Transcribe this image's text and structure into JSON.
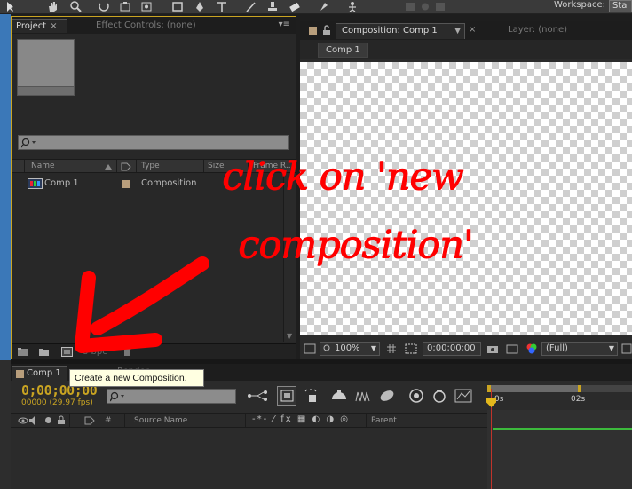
{
  "toolbar": {
    "workspace_label": "Workspace:",
    "workspace_value": "Sta",
    "tools": [
      "selection-tool",
      "hand-tool",
      "zoom-tool",
      "rotate-tool",
      "camera-tool",
      "pan-behind-tool",
      "rectangle-tool",
      "pen-tool",
      "type-tool",
      "brush-tool",
      "clone-stamp-tool",
      "eraser-tool",
      "roto-brush-tool",
      "puppet-tool"
    ]
  },
  "project_panel": {
    "tab_project": "Project",
    "tab_effect_controls": "Effect Controls: (none)",
    "columns": {
      "name": "Name",
      "type": "Type",
      "size": "Size",
      "frame_rate": "Frame R..."
    },
    "items": [
      {
        "name": "Comp 1",
        "type": "Composition",
        "size": "",
        "frame_rate": ""
      }
    ],
    "bit_depth": "8 bpc"
  },
  "comp_panel": {
    "tab_composition": "Composition: Comp 1",
    "tab_layer": "Layer: (none)",
    "subtab": "Comp 1",
    "zoom": "100%",
    "timecode": "0;00;00;00",
    "resolution": "(Full)"
  },
  "timeline": {
    "tab": "Comp 1",
    "timecode": "0;00;00;00",
    "fps": "00000 (29.97 fps)",
    "columns": {
      "number": "#",
      "source_name": "Source Name",
      "parent": "Parent"
    },
    "ruler_marks": [
      "0s",
      "02s"
    ]
  },
  "tooltip": "Create a new Composition.",
  "annotation": {
    "line1": "click on 'new",
    "line2": "composition'",
    "color": "#ff0000"
  },
  "colors": {
    "accent": "#c9a422",
    "panel_bg": "#282828",
    "timecode": "#c9a422",
    "playhead": "#e3b81c",
    "track": "#3cba3c"
  }
}
